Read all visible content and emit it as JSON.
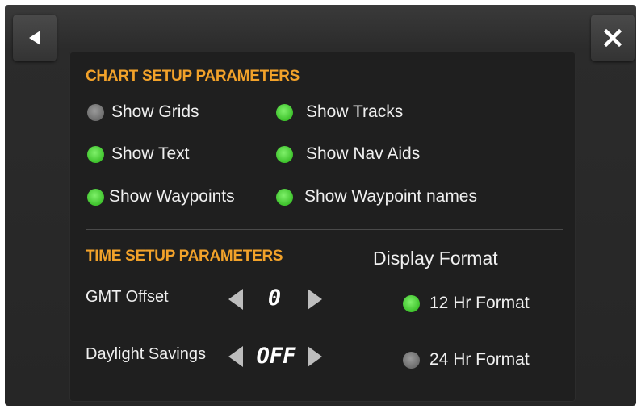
{
  "chart_setup": {
    "title": "CHART SETUP PARAMETERS",
    "options": [
      {
        "label": "Show Grids",
        "enabled": false
      },
      {
        "label": "Show Tracks",
        "enabled": true
      },
      {
        "label": "Show Text",
        "enabled": true
      },
      {
        "label": "Show Nav Aids",
        "enabled": true
      },
      {
        "label": "Show Waypoints",
        "enabled": true
      },
      {
        "label": "Show Waypoint names",
        "enabled": true
      }
    ]
  },
  "time_setup": {
    "title": "TIME SETUP PARAMETERS",
    "gmt_offset_label": "GMT Offset",
    "gmt_offset_value": "0",
    "daylight_label": "Daylight Savings",
    "daylight_value": "OFF"
  },
  "display_format": {
    "title": "Display Format",
    "options": [
      {
        "label": "12 Hr Format",
        "selected": true
      },
      {
        "label": "24 Hr Format",
        "selected": false
      }
    ]
  },
  "colors": {
    "accent": "#f2a22a",
    "on": "#4cd43a",
    "off": "#7a7a7a"
  },
  "icons": {
    "back": "back-arrow-icon",
    "close": "close-icon"
  }
}
